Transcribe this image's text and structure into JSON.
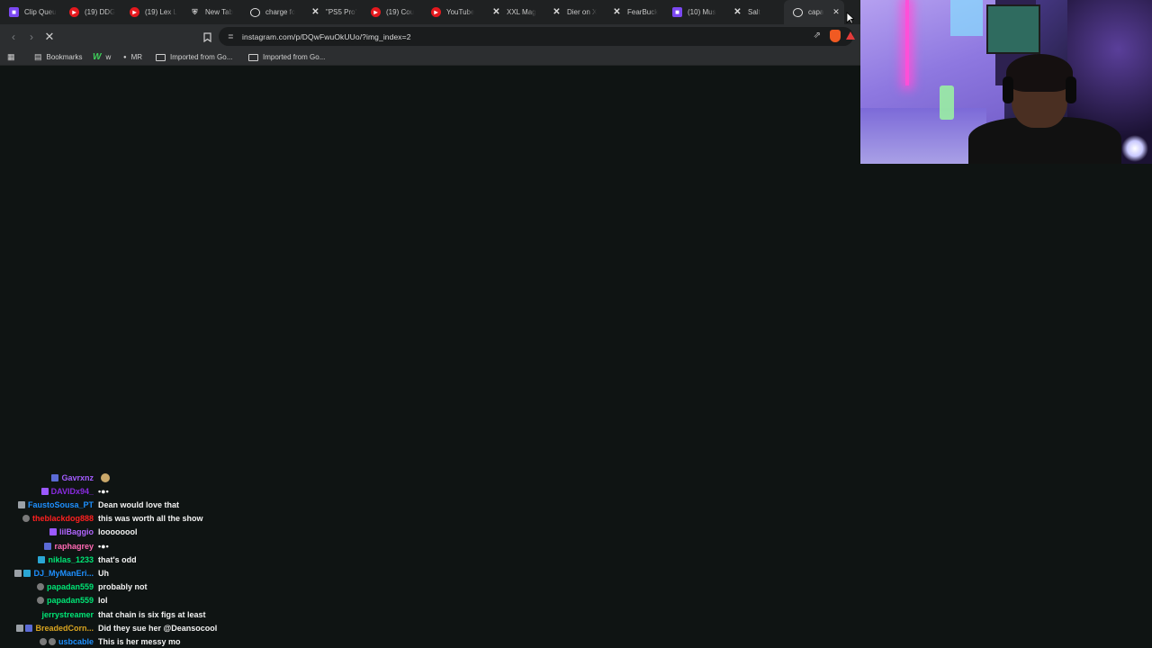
{
  "browser": {
    "tabs": [
      {
        "title": "Clip Queu",
        "icon": "twitch-icon",
        "fav": "twitch"
      },
      {
        "title": "(19) DDG",
        "icon": "youtube-icon",
        "fav": "yt"
      },
      {
        "title": "(19) Lex L",
        "icon": "youtube-icon",
        "fav": "yt"
      },
      {
        "title": "New Tab",
        "icon": "brave-icon",
        "fav": "brave"
      },
      {
        "title": "charge fo",
        "icon": "google-icon",
        "fav": "google"
      },
      {
        "title": "\"PS5 Pro\"",
        "icon": "x-icon",
        "fav": "x"
      },
      {
        "title": "(19) Cou",
        "icon": "youtube-icon",
        "fav": "yt"
      },
      {
        "title": "YouTube",
        "icon": "youtube-icon",
        "fav": "yt"
      },
      {
        "title": "XXL Mag",
        "icon": "x-icon",
        "fav": "x"
      },
      {
        "title": "Dier on X",
        "icon": "x-icon",
        "fav": "x"
      },
      {
        "title": "FearBuck",
        "icon": "x-icon",
        "fav": "x"
      },
      {
        "title": "(10) Mus",
        "icon": "twitch-icon",
        "fav": "twitch"
      },
      {
        "title": "Salt",
        "icon": "x-icon",
        "fav": "x"
      },
      {
        "title": "capa",
        "icon": "google-icon",
        "fav": "google",
        "active": true
      }
    ],
    "url": "instagram.com/p/DQwFwuOkUUo/?img_index=2",
    "bookmarks": [
      {
        "label": "Bookmarks",
        "icon": "bookmarks-icon"
      },
      {
        "label": "w",
        "icon": "w-icon"
      },
      {
        "label": "MR",
        "icon": "mr-icon"
      },
      {
        "label": "Imported from Go...",
        "icon": "folder-icon"
      },
      {
        "label": "Imported from Go...",
        "icon": "folder-icon"
      }
    ]
  },
  "chat": {
    "messages": [
      {
        "user": "Gavrxnz",
        "color": "#a35cff",
        "msg": "",
        "emote": true
      },
      {
        "user": "DAVIDx94_",
        "color": "#8a2be2",
        "msg": "•●•",
        "emote": false
      },
      {
        "user": "FaustoSousa_PT",
        "color": "#1e90ff",
        "msg": "Dean would love that"
      },
      {
        "user": "theblackdog888",
        "color": "#ff2020",
        "msg": "this was worth all the show"
      },
      {
        "user": "lilBaggio",
        "color": "#b266ff",
        "msg": "loooooool"
      },
      {
        "user": "raphagrey",
        "color": "#ff69b4",
        "msg": "•●•"
      },
      {
        "user": "niklas_1233",
        "color": "#00e676",
        "msg": "that's odd"
      },
      {
        "user": "DJ_MyManEri...",
        "color": "#1e90ff",
        "msg": "Uh"
      },
      {
        "user": "papadan559",
        "color": "#00e676",
        "msg": "probably not"
      },
      {
        "user": "papadan559",
        "color": "#00e676",
        "msg": "lol"
      },
      {
        "user": "jerrystreamer",
        "color": "#00e676",
        "msg": "that chain is six figs at least"
      },
      {
        "user": "BreadedCorn...",
        "color": "#daa520",
        "msg": "Did they sue her @Deansocool"
      },
      {
        "user": "usbcable",
        "color": "#1e90ff",
        "msg": "This is her messy mo"
      }
    ]
  }
}
